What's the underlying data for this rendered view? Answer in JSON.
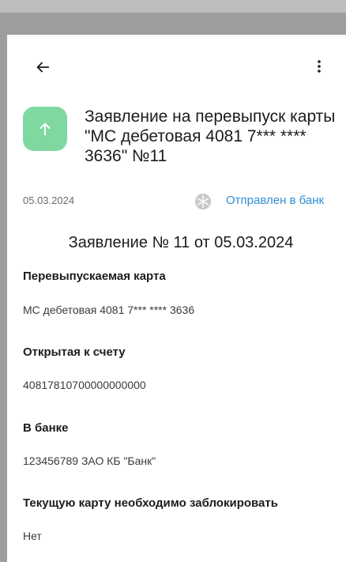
{
  "header": {
    "title": "Заявление на перевыпуск карты \"МС дебетовая 4081 7*** **** 3636\" №11"
  },
  "meta": {
    "date": "05.03.2024",
    "status": "Отправлен в банк"
  },
  "document": {
    "heading": "Заявление № 11 от 05.03.2024",
    "fields": [
      {
        "label": "Перевыпускаемая карта",
        "value": "МС дебетовая 4081 7*** **** 3636"
      },
      {
        "label": "Открытая к счету",
        "value": "40817810700000000000"
      },
      {
        "label": "В банке",
        "value": "123456789 ЗАО КБ \"Банк\""
      },
      {
        "label": "Текущую карту необходимо заблокировать",
        "value": "Нет"
      }
    ]
  },
  "colors": {
    "icon_bg": "#7fd8a0",
    "status": "#2f8ed6"
  },
  "icons": {
    "back": "arrow-left-icon",
    "menu": "more-vertical-icon",
    "doc": "arrow-up-icon",
    "status": "snowflake-icon"
  }
}
